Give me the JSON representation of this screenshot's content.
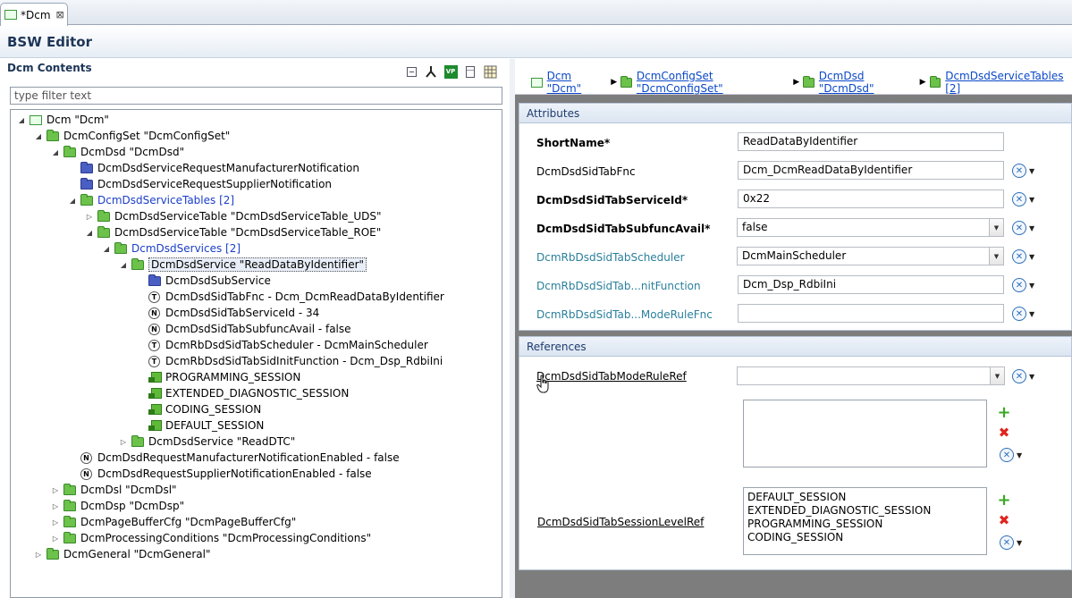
{
  "tab": {
    "label": "*Dcm",
    "close": "⊠"
  },
  "editor": {
    "title": "BSW Editor"
  },
  "contents": {
    "title": "Dcm Contents",
    "toolbar_icons": [
      "collapse-all-icon",
      "hierarchy-icon",
      "vp-res-icon",
      "document-icon",
      "table-icon"
    ],
    "vp_label": "VP",
    "filter_placeholder": "type filter text"
  },
  "tree": [
    {
      "label": "Dcm \"Dcm\"",
      "indent": 0,
      "icon": "module",
      "arrow": "open"
    },
    {
      "label": "DcmConfigSet \"DcmConfigSet\"",
      "indent": 1,
      "icon": "folder",
      "arrow": "open"
    },
    {
      "label": "DcmDsd \"DcmDsd\"",
      "indent": 2,
      "icon": "folder",
      "arrow": "open"
    },
    {
      "label": "DcmDsdServiceRequestManufacturerNotification",
      "indent": 3,
      "icon": "folder-blue",
      "arrow": "none"
    },
    {
      "label": "DcmDsdServiceRequestSupplierNotification",
      "indent": 3,
      "icon": "folder-blue",
      "arrow": "none"
    },
    {
      "label": "DcmDsdServiceTables [2]",
      "indent": 3,
      "icon": "folder",
      "arrow": "open",
      "style": "blue"
    },
    {
      "label": "DcmDsdServiceTable \"DcmDsdServiceTable_UDS\"",
      "indent": 4,
      "icon": "folder",
      "arrow": "closed"
    },
    {
      "label": "DcmDsdServiceTable \"DcmDsdServiceTable_ROE\"",
      "indent": 4,
      "icon": "folder",
      "arrow": "open"
    },
    {
      "label": "DcmDsdServices [2]",
      "indent": 5,
      "icon": "folder",
      "arrow": "open",
      "style": "blue"
    },
    {
      "label": "DcmDsdService \"ReadDataByIdentifier\"",
      "indent": 6,
      "icon": "folder",
      "arrow": "open",
      "style": "selected"
    },
    {
      "label": "DcmDsdSubService",
      "indent": 7,
      "icon": "folder-blue",
      "arrow": "none"
    },
    {
      "label": "DcmDsdSidTabFnc - Dcm_DcmReadDataByIdentifier",
      "indent": 7,
      "icon": "param-T",
      "arrow": "none"
    },
    {
      "label": "DcmDsdSidTabServiceId - 34",
      "indent": 7,
      "icon": "param-N",
      "arrow": "none"
    },
    {
      "label": "DcmDsdSidTabSubfuncAvail - false",
      "indent": 7,
      "icon": "param-N",
      "arrow": "none"
    },
    {
      "label": "DcmRbDsdSidTabScheduler - DcmMainScheduler",
      "indent": 7,
      "icon": "param-T",
      "arrow": "none"
    },
    {
      "label": "DcmRbDsdSidTabSidInitFunction - Dcm_Dsp_RdbiIni",
      "indent": 7,
      "icon": "param-T",
      "arrow": "none"
    },
    {
      "label": "PROGRAMMING_SESSION",
      "indent": 7,
      "icon": "reference",
      "arrow": "none"
    },
    {
      "label": "EXTENDED_DIAGNOSTIC_SESSION",
      "indent": 7,
      "icon": "reference",
      "arrow": "none"
    },
    {
      "label": "CODING_SESSION",
      "indent": 7,
      "icon": "reference",
      "arrow": "none"
    },
    {
      "label": "DEFAULT_SESSION",
      "indent": 7,
      "icon": "reference",
      "arrow": "none"
    },
    {
      "label": "DcmDsdService \"ReadDTC\"",
      "indent": 6,
      "icon": "folder",
      "arrow": "closed"
    },
    {
      "label": "DcmDsdRequestManufacturerNotificationEnabled - false",
      "indent": 3,
      "icon": "param-N",
      "arrow": "none"
    },
    {
      "label": "DcmDsdRequestSupplierNotificationEnabled - false",
      "indent": 3,
      "icon": "param-N",
      "arrow": "none"
    },
    {
      "label": "DcmDsl \"DcmDsl\"",
      "indent": 2,
      "icon": "folder",
      "arrow": "closed"
    },
    {
      "label": "DcmDsp \"DcmDsp\"",
      "indent": 2,
      "icon": "folder",
      "arrow": "closed"
    },
    {
      "label": "DcmPageBufferCfg \"DcmPageBufferCfg\"",
      "indent": 2,
      "icon": "folder",
      "arrow": "closed"
    },
    {
      "label": "DcmProcessingConditions \"DcmProcessingConditions\"",
      "indent": 2,
      "icon": "folder",
      "arrow": "closed"
    },
    {
      "label": "DcmGeneral \"DcmGeneral\"",
      "indent": 1,
      "icon": "folder",
      "arrow": "closed"
    }
  ],
  "breadcrumb": [
    {
      "label": "Dcm \"Dcm\"",
      "icon": "module"
    },
    {
      "label": "DcmConfigSet \"DcmConfigSet\"",
      "icon": "folder"
    },
    {
      "label": "DcmDsd \"DcmDsd\"",
      "icon": "folder"
    },
    {
      "label": "DcmDsdServiceTables [2]",
      "icon": "folder"
    }
  ],
  "attributes": {
    "title": "Attributes",
    "rows": [
      {
        "label": "ShortName*",
        "value": "ReadDataByIdentifier",
        "style": "bold",
        "control": "text",
        "reset": false
      },
      {
        "label": "DcmDsdSidTabFnc",
        "value": "Dcm_DcmReadDataByIdentifier",
        "style": "normal",
        "control": "text",
        "reset": true
      },
      {
        "label": "DcmDsdSidTabServiceId*",
        "value": "0x22",
        "style": "bold",
        "control": "text",
        "reset": true
      },
      {
        "label": "DcmDsdSidTabSubfuncAvail*",
        "value": "false",
        "style": "bold",
        "control": "combo",
        "reset": true
      },
      {
        "label": "DcmRbDsdSidTabScheduler",
        "value": "DcmMainScheduler",
        "style": "teal",
        "control": "combo",
        "reset": true
      },
      {
        "label": "DcmRbDsdSidTab...nitFunction",
        "value": "Dcm_Dsp_RdbiIni",
        "style": "teal",
        "control": "text",
        "reset": true
      },
      {
        "label": "DcmRbDsdSidTab...ModeRuleFnc",
        "value": "",
        "style": "teal",
        "control": "text",
        "reset": true
      }
    ]
  },
  "references": {
    "title": "References",
    "mode_rule_ref": {
      "label": "DcmDsdSidTabModeRuleRef",
      "value": ""
    },
    "mode_rule_list": [],
    "session_level_ref": {
      "label": "DcmDsdSidTabSessionLevelRef",
      "values": [
        "DEFAULT_SESSION",
        "EXTENDED_DIAGNOSTIC_SESSION",
        "PROGRAMMING_SESSION",
        "CODING_SESSION"
      ]
    }
  },
  "glyphs": {
    "reset": "✕",
    "dropdown": "▼",
    "plus": "+",
    "delete": "✖",
    "tree_open": "◢",
    "tree_closed": "▷",
    "crumb_sep": "▶"
  }
}
